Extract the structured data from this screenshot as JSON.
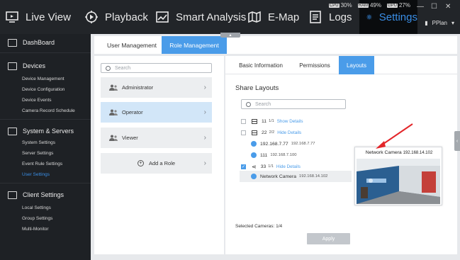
{
  "topnav": {
    "items": [
      {
        "label": "Live View",
        "icon": "monitor-icon"
      },
      {
        "label": "Playback",
        "icon": "play-circle-icon"
      },
      {
        "label": "Smart Analysis",
        "icon": "chart-icon"
      },
      {
        "label": "E-Map",
        "icon": "map-icon"
      },
      {
        "label": "Logs",
        "icon": "document-icon"
      },
      {
        "label": "Settings",
        "icon": "gear-icon"
      }
    ],
    "active": "Settings",
    "stats": [
      {
        "tag": "CPU",
        "value": "30%"
      },
      {
        "tag": "RAM",
        "value": "49%"
      },
      {
        "tag": "GPU",
        "value": "27%"
      }
    ],
    "user": "PPlan"
  },
  "sidebar": {
    "dashboard": "DashBoard",
    "devices": {
      "title": "Devices",
      "items": [
        "Device Management",
        "Device Configuration",
        "Device Events",
        "Camera Record Schedule"
      ]
    },
    "system": {
      "title": "System & Servers",
      "items": [
        "System Settings",
        "Server Settings",
        "Event Rule Settings",
        "User Settings"
      ],
      "active": "User Settings"
    },
    "client": {
      "title": "Client Settings",
      "items": [
        "Local Settings",
        "Group Settings",
        "Multi-Monitor"
      ]
    }
  },
  "main": {
    "tabs": [
      {
        "label": "User Management"
      },
      {
        "label": "Role Management"
      }
    ],
    "active_tab": "Role Management",
    "roles_search_placeholder": "Search",
    "roles": [
      {
        "label": "Administrator"
      },
      {
        "label": "Operator"
      },
      {
        "label": "Viewer"
      }
    ],
    "active_role": "Operator",
    "add_role": "Add a Role",
    "detail_tabs": [
      {
        "label": "Basic Information"
      },
      {
        "label": "Permissions"
      },
      {
        "label": "Layouts"
      }
    ],
    "active_detail_tab": "Layouts",
    "share_layouts_title": "Share Layouts",
    "layouts_search_placeholder": "Search",
    "tree": [
      {
        "name": "11",
        "count": "1/1",
        "action": "Show Details",
        "checked": false
      },
      {
        "name": "22",
        "count": "2/2",
        "action": "Hide Details",
        "checked": false,
        "cameras": [
          {
            "name": "192.168.7.77",
            "ip": "192.168.7.77"
          },
          {
            "name": "111",
            "ip": "192.168.7.100"
          }
        ]
      },
      {
        "name": "33",
        "count": "1/1",
        "action": "Hide Details",
        "checked": true,
        "cameras": [
          {
            "name": "Network Camera",
            "ip": "192.168.14.102"
          }
        ]
      }
    ],
    "selected_cameras": "Selected Cameras: 1/4",
    "apply_label": "Apply",
    "preview": {
      "camera": "Network Camera",
      "ip": "192.168.14.102"
    }
  },
  "colors": {
    "accent": "#4a9ce9",
    "topbar": "#222529",
    "sidebar": "#1e2125",
    "arrow": "#e3262a"
  }
}
